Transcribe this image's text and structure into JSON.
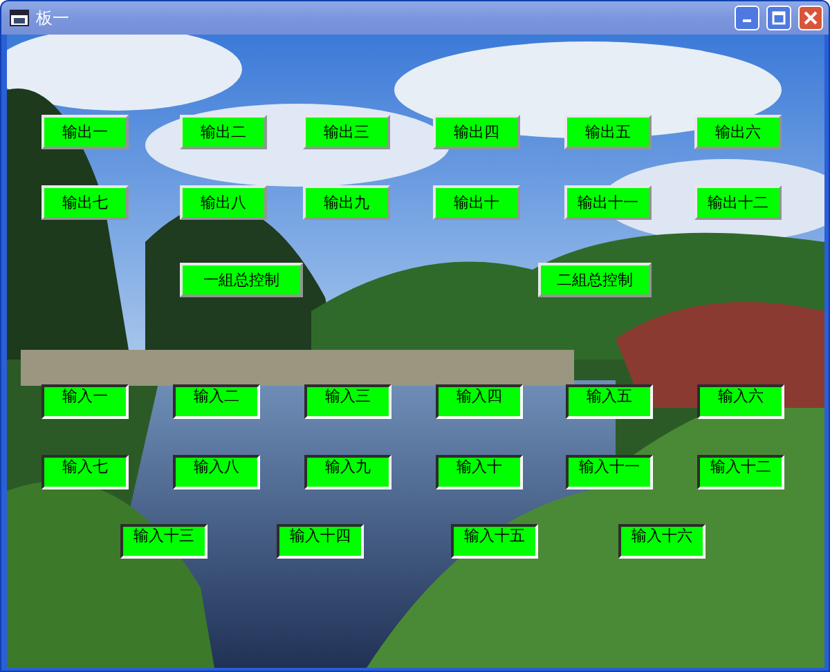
{
  "window": {
    "title": "板一"
  },
  "outputs": [
    "输出一",
    "输出二",
    "输出三",
    "输出四",
    "输出五",
    "输出六",
    "输出七",
    "输出八",
    "输出九",
    "输出十",
    "输出十一",
    "输出十二"
  ],
  "group_controls": [
    "一組总控制",
    "二組总控制"
  ],
  "inputs": [
    "输入一",
    "输入二",
    "输入三",
    "输入四",
    "输入五",
    "输入六",
    "输入七",
    "输入八",
    "输入九",
    "输入十",
    "输入十一",
    "输入十二",
    "输入十三",
    "输入十四",
    "输入十五",
    "输入十六"
  ]
}
